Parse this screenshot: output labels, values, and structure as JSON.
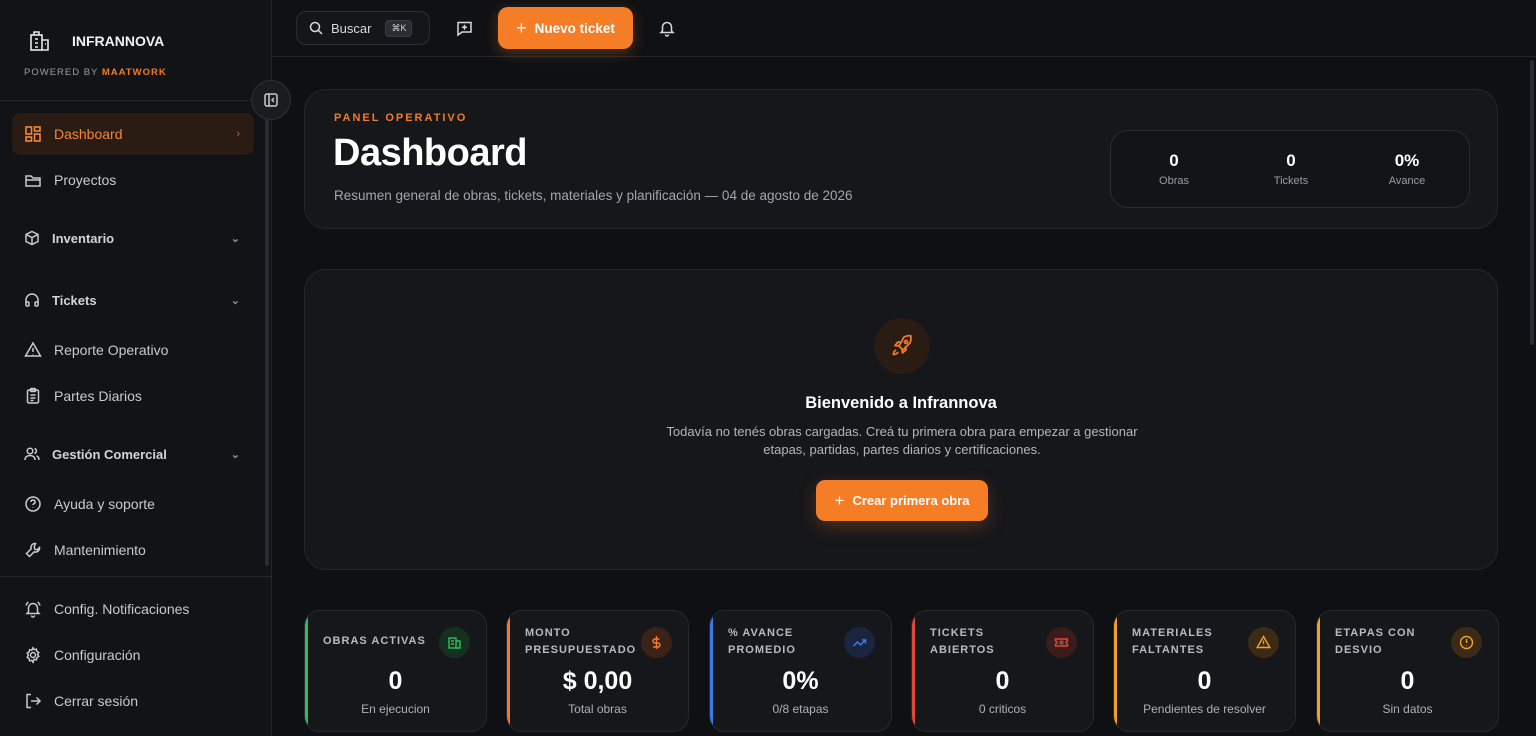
{
  "brand": {
    "name": "INFRANNOVA",
    "powered_prefix": "POWERED BY",
    "powered_by": "MAATWORK"
  },
  "search": {
    "label": "Buscar",
    "shortcut": "⌘K"
  },
  "topbar": {
    "new_ticket_label": "Nuevo ticket"
  },
  "sidebar": {
    "items": [
      {
        "label": "Dashboard",
        "icon": "dashboard-icon",
        "active": true
      },
      {
        "label": "Proyectos",
        "icon": "folder-icon"
      },
      {
        "label": "Inventario",
        "icon": "box-icon",
        "expandable": true
      },
      {
        "label": "Tickets",
        "icon": "headphones-icon",
        "expandable": true
      },
      {
        "label": "Reporte Operativo",
        "icon": "alert-triangle-icon"
      },
      {
        "label": "Partes Diarios",
        "icon": "clipboard-icon"
      },
      {
        "label": "Gestión Comercial",
        "icon": "users-icon",
        "expandable": true
      },
      {
        "label": "Ayuda y soporte",
        "icon": "help-circle-icon"
      },
      {
        "label": "Mantenimiento",
        "icon": "wrench-icon"
      }
    ],
    "footer": [
      {
        "label": "Config. Notificaciones",
        "icon": "bell-ring-icon"
      },
      {
        "label": "Configuración",
        "icon": "gear-icon"
      },
      {
        "label": "Cerrar sesión",
        "icon": "logout-icon"
      }
    ]
  },
  "header": {
    "eyebrow": "PANEL OPERATIVO",
    "title": "Dashboard",
    "subtitle": "Resumen general de obras, tickets, materiales y planificación — 04 de agosto de 2026",
    "stats": [
      {
        "value": "0",
        "label": "Obras"
      },
      {
        "value": "0",
        "label": "Tickets"
      },
      {
        "value": "0%",
        "label": "Avance"
      }
    ]
  },
  "welcome": {
    "title": "Bienvenido a Infrannova",
    "text": "Todavía no tenés obras cargadas. Creá tu primera obra para empezar a gestionar etapas, partidas, partes diarios y certificaciones.",
    "button": "Crear primera obra"
  },
  "kpis": [
    {
      "title": "OBRAS ACTIVAS",
      "value": "0",
      "sub": "En ejecucion",
      "color": "#2fbf5a",
      "icon": "building-icon"
    },
    {
      "title": "MONTO PRESUPUESTADO",
      "value": "$ 0,00",
      "sub": "Total obras",
      "color": "#f27b2b",
      "icon": "dollar-icon"
    },
    {
      "title": "% AVANCE PROMEDIO",
      "value": "0%",
      "sub": "0/8 etapas",
      "color": "#3d7be8",
      "icon": "trending-up-icon"
    },
    {
      "title": "TICKETS ABIERTOS",
      "value": "0",
      "sub": "0 criticos",
      "color": "#e0483a",
      "icon": "ticket-icon"
    },
    {
      "title": "MATERIALES FALTANTES",
      "value": "0",
      "sub": "Pendientes de resolver",
      "color": "#f0a126",
      "icon": "warning-icon"
    },
    {
      "title": "ETAPAS CON DESVIO",
      "value": "0",
      "sub": "Sin datos",
      "color": "#f0a126",
      "icon": "alert-circle-icon"
    }
  ]
}
